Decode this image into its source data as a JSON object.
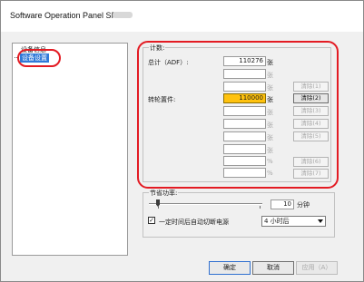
{
  "window": {
    "title": "Software Operation Panel SP-"
  },
  "tree": {
    "parent_label": "设备信息",
    "selected_label": "设备设置"
  },
  "counter_group": {
    "caption": "计数:",
    "total_label": "总计（ADF）:",
    "total_value": "110276",
    "roller_label": "转轮置件:",
    "roller_value": "110000",
    "unit": "张",
    "unit_alt": "%",
    "clear_buttons": [
      "清除(1)",
      "清除(2)",
      "清除(3)",
      "清除(4)",
      "清除(5)",
      "清除(6)",
      "清除(7)"
    ]
  },
  "power_group": {
    "caption": "节省功率:",
    "value": "10",
    "unit": "分钟",
    "auto_off_label": "一定时间后自动切断电源",
    "auto_off_checked": true,
    "auto_off_option": "4 小时后"
  },
  "footer": {
    "ok_label": "确定",
    "cancel_label": "取消",
    "apply_label": "应用（A）"
  },
  "colors": {
    "highlight": "#e31b23",
    "selection": "#3079d8",
    "counter_warning": "#ffc20e"
  }
}
